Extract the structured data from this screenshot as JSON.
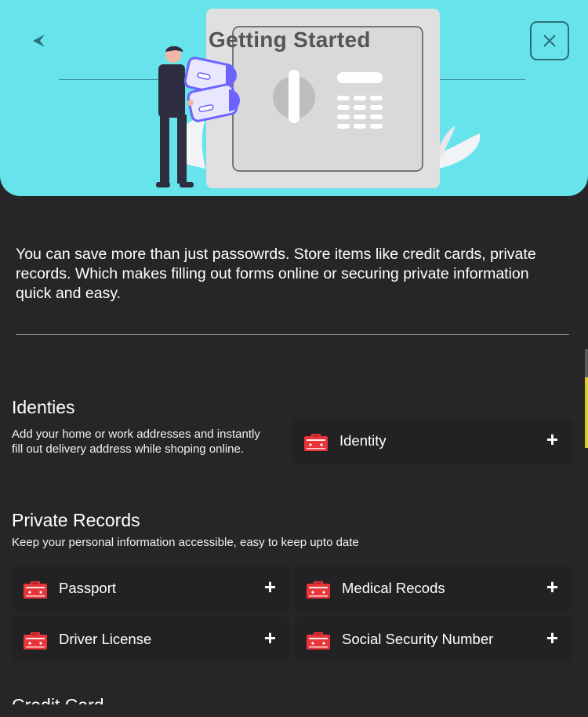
{
  "header": {
    "title": "Getting Started",
    "back_icon": "back-arrow-icon",
    "close_icon": "close-icon",
    "hero_color": "#67e3ec"
  },
  "intro": "You can save more than just passowrds. Store items like credit cards, private records. Which makes filling out forms online or securing private information quick and easy.",
  "identities": {
    "title": "Identies",
    "description_line1": "Add your home or work addresses and instantly",
    "description_line2": "fill out delivery address while shoping online.",
    "cards": [
      {
        "label": "Identity",
        "icon": "id-card-icon",
        "action": "+"
      }
    ]
  },
  "private_records": {
    "title": "Private Records",
    "description": "Keep your personal information accessible, easy to keep upto date",
    "cards": [
      {
        "label": "Passport",
        "icon": "id-card-icon",
        "action": "+"
      },
      {
        "label": "Medical Recods",
        "icon": "id-card-icon",
        "action": "+"
      },
      {
        "label": "Driver License",
        "icon": "id-card-icon",
        "action": "+"
      },
      {
        "label": "Social Security Number",
        "icon": "id-card-icon",
        "action": "+"
      }
    ]
  },
  "next_section": {
    "title": "Credit Card"
  },
  "colors": {
    "background": "#262628",
    "card": "#222224",
    "icon_red": "#e8353a"
  }
}
